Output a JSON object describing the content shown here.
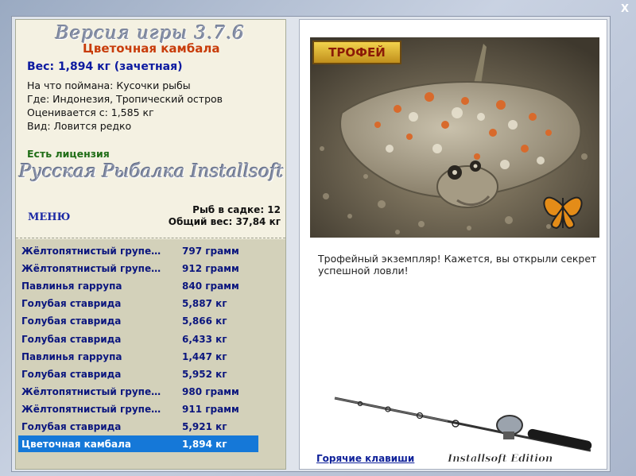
{
  "window": {
    "close_label": "X"
  },
  "header": {
    "version_title": "Версия игры   3.7.6",
    "fish_name": "Цветочная камбала",
    "weight_line": "Вес: 1,894 кг (зачетная)"
  },
  "info": {
    "bait": "На что поймана: Кусочки рыбы",
    "location": "Где: Индонезия, Тропический остров",
    "rated_from": "Оценивается с: 1,585 кг",
    "species": "Вид: Ловится редко"
  },
  "license_text": "Есть лицензия",
  "brand_title": "Русская Рыбалка Installsoft",
  "menu_label": "МЕНЮ",
  "stats": {
    "fish_in_keepnet": "Рыб в садке: 12",
    "total_weight": "Общий вес: 37,84 кг"
  },
  "catch_list": [
    {
      "name": "Жёлтопятнистый групе…",
      "weight": "797 грамм"
    },
    {
      "name": "Жёлтопятнистый групе…",
      "weight": "912 грамм"
    },
    {
      "name": "Павлинья гаррупа",
      "weight": "840 грамм"
    },
    {
      "name": "Голубая ставрида",
      "weight": "5,887 кг"
    },
    {
      "name": "Голубая ставрида",
      "weight": "5,866 кг"
    },
    {
      "name": "Голубая ставрида",
      "weight": "6,433 кг"
    },
    {
      "name": "Павлинья гаррупа",
      "weight": "1,447 кг"
    },
    {
      "name": "Голубая ставрида",
      "weight": "5,952 кг"
    },
    {
      "name": "Жёлтопятнистый групе…",
      "weight": "980 грамм"
    },
    {
      "name": "Жёлтопятнистый групе…",
      "weight": "911 грамм"
    },
    {
      "name": "Голубая ставрида",
      "weight": "5,921 кг"
    },
    {
      "name": "Цветочная камбала",
      "weight": "1,894 кг",
      "selected": true
    }
  ],
  "trophy": {
    "badge": "ТРОФЕЙ",
    "message": "Трофейный экземпляр! Кажется, вы открыли секрет успешной ловли!"
  },
  "hotkeys_label": "Горячие клавиши",
  "logo_text": "Installsoft Edition",
  "colors": {
    "selected_row": "#1578d8",
    "fish_name": "#c83c0a",
    "weight_text": "#0c1aa0",
    "license": "#1f6d16",
    "list_bg": "#d3d1ba"
  }
}
